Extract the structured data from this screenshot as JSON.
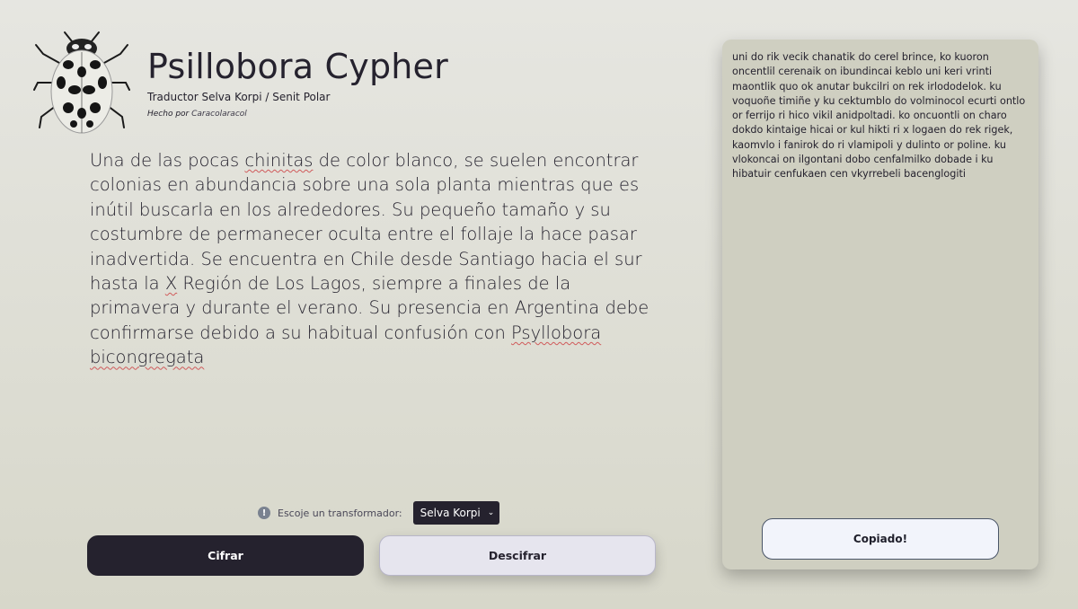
{
  "header": {
    "title": "Psillobora Cypher",
    "subtitle": "Traductor Selva Korpi / Senit Polar",
    "credit_prefix": "Hecho por",
    "credit_author": "Caracolaracol",
    "logo_icon": "ladybug-icon"
  },
  "input": {
    "segments": [
      "Una de las pocas ",
      "chinitas",
      " de color blanco, se suelen encontrar colonias en abundancia sobre una sola planta mientras que es inútil buscarla en los alrededores. Su pequeño tamaño y su costumbre de permanecer oculta entre el follaje la hace pasar inadvertida. Se encuentra en Chile desde Santiago hacia el sur hasta la ",
      "X",
      " Región de Los Lagos, siempre a finales de la primavera y durante el verano. Su presencia en Argentina debe confirmarse debido a su habitual confusión con ",
      "Psyllobora",
      " ",
      "bicongregata"
    ]
  },
  "controls": {
    "selector_label": "Escoje un transformador:",
    "selector_value": "Selva Korpi",
    "encrypt_label": "Cifrar",
    "decrypt_label": "Descifrar"
  },
  "output": {
    "text": "uni do rik vecik chanatik do cerel brince, ko kuoron oncentlil cerenaik on ibundincai keblo uni keri vrinti maontlik quo ok anutar bukcilri on rek irlododelok. ku voquoñe timiñe y ku cektumblo do volminocol ecurti ontlo or ferrijo ri hico vikil anidpoltadi. ko oncuontli on charo dokdo kintaige hicai or kul hikti ri x logaen do rek rigek, kaomvlo i fanirok do ri vlamipoli y dulinto or poline. ku vlokoncai on ilgontani dobo cenfalmilko dobade i ku hibatuir cenfukaen cen vkyrrebeli bacenglogiti",
    "copy_label": "Copiado!"
  },
  "colors": {
    "dark": "#25222e",
    "card": "#cfcfc1",
    "light_button": "#e6e5ee"
  }
}
